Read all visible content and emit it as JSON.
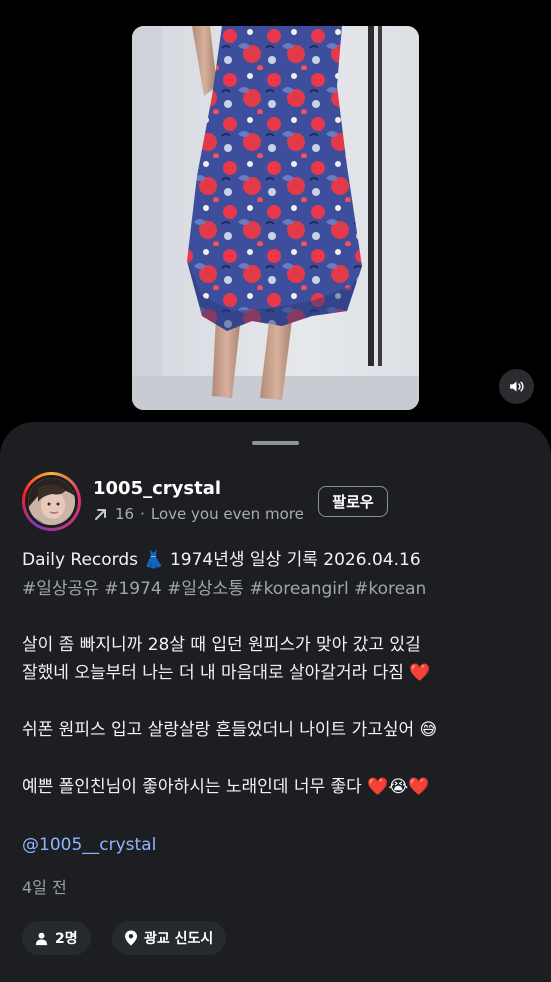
{
  "post": {
    "username": "1005_crystal",
    "repost_count": "16",
    "separator": "·",
    "music": "Love you even more",
    "follow_label": "팔로우",
    "caption_line1": "Daily Records 👗 1974년생 일상 기록 2026.04.16",
    "hashtags": "#일상공유 #1974 #일상소통 #koreangirl #korean",
    "caption_line2": "살이 좀 빠지니까 28살 때 입던 원피스가 맞아 갔고 있길",
    "caption_line3": "잘했네 오늘부터 나는 더 내 마음대로 살아갈거라 다짐 ❤️",
    "caption_line4": "쉬폰 원피스 입고 살랑살랑 흔들었더니 나이트 가고싶어 😅",
    "caption_line5": "예쁜 폴인친님이 좋아하시는 노래인데 너무 좋다 ❤️😭❤️",
    "mention": "@1005__crystal",
    "time": "4일 전",
    "people_count": "2명",
    "location": "광교 신도시"
  },
  "icons": {
    "volume": "volume-icon",
    "repost": "arrow-up-right-icon",
    "person": "person-icon",
    "location": "location-pin-icon"
  },
  "colors": {
    "background": "#000000",
    "sheet": "#1c1e22",
    "hashtag": "#a1a5ab",
    "mention": "#8fb4ff",
    "dress_red": "#e8384a",
    "dress_blue": "#3d4f9c"
  }
}
